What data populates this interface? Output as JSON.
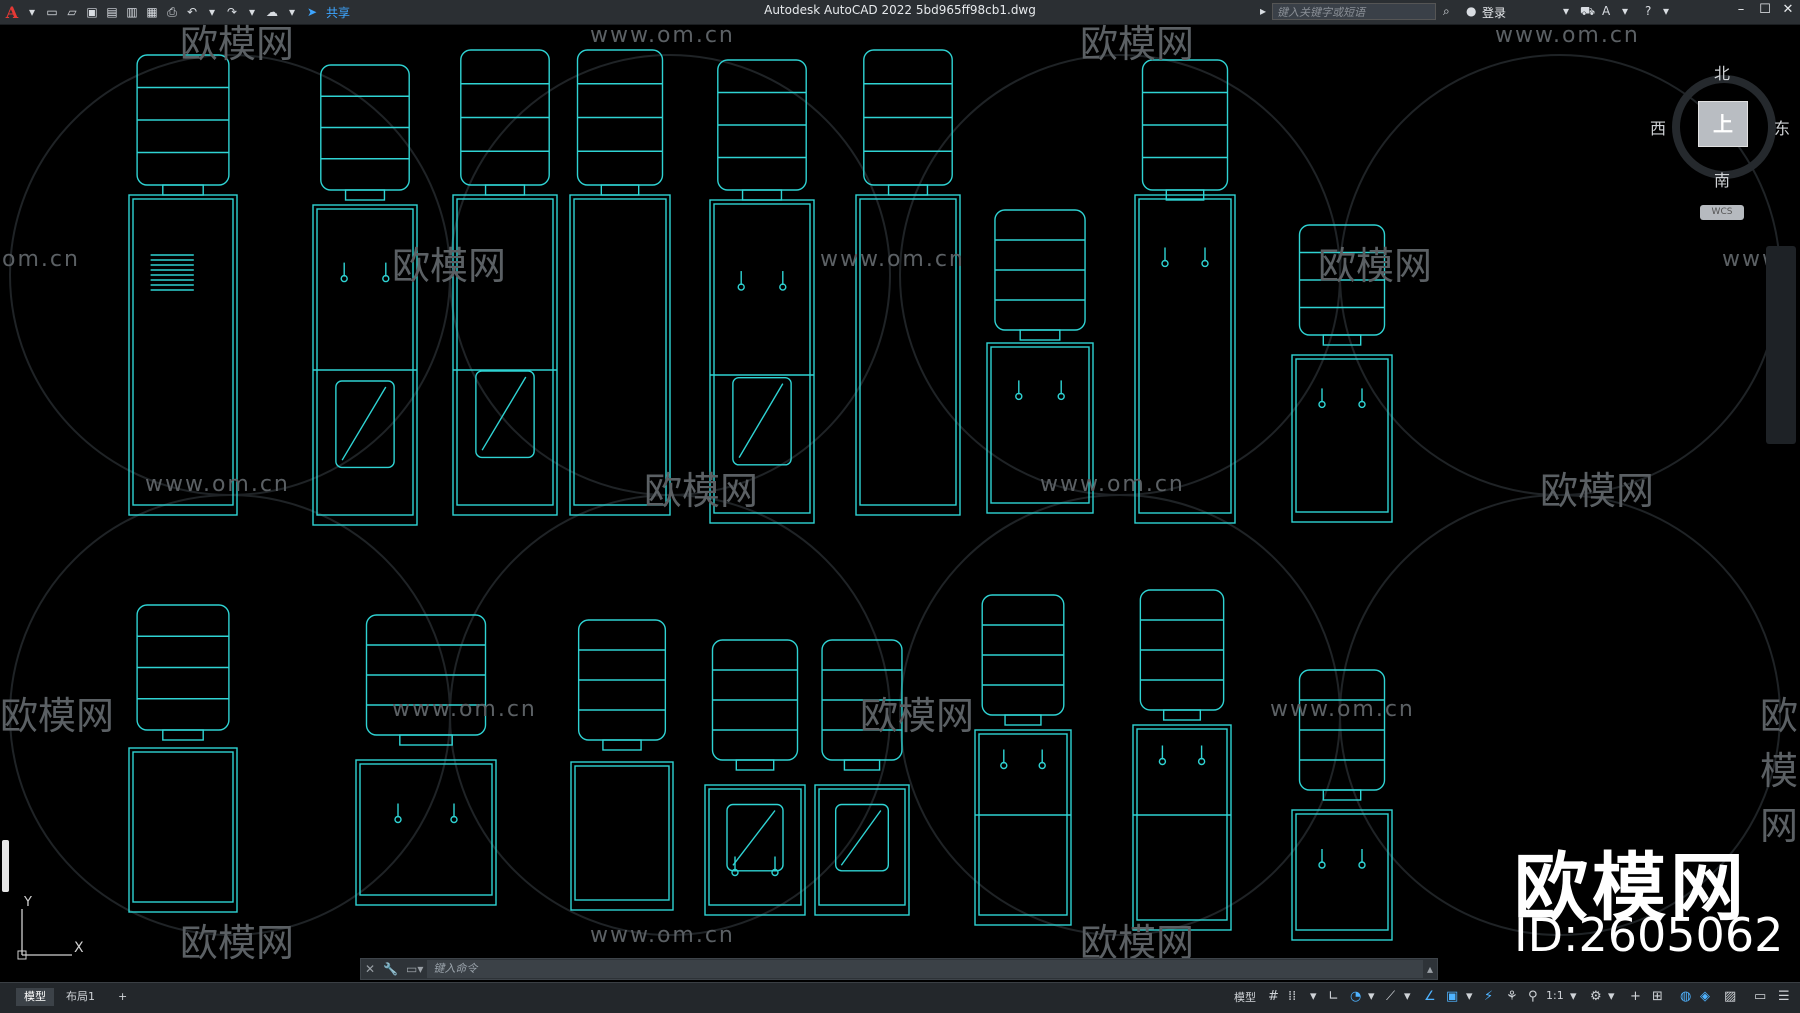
{
  "titlebar": {
    "app_logo": "A",
    "share_label": "共享",
    "title": "Autodesk AutoCAD 2022    5bd965ff98cb1.dwg",
    "search_placeholder": "键入关键字或短语",
    "login_label": "登录",
    "quick_access_icons": [
      "new-icon",
      "open-icon",
      "save-icon",
      "saveas-icon",
      "print-icon",
      "plot-icon",
      "undo-icon",
      "redo-icon",
      "share-icon"
    ]
  },
  "viewcube": {
    "north": "北",
    "south": "南",
    "west": "西",
    "east": "东",
    "face": "上",
    "wcs": "WCS"
  },
  "watermarks": {
    "brand": "欧模网",
    "url": "www.om.cn",
    "url_partial_left": "om.cn",
    "url_partial_right": "www.",
    "big_brand": "欧模网",
    "big_id": "ID:2605062"
  },
  "ucs": {
    "y": "Y",
    "x": "X"
  },
  "command_line": {
    "placeholder": "键入命令"
  },
  "statusbar": {
    "tabs": [
      "模型",
      "布局1"
    ],
    "add_tab": "+",
    "model_label": "模型",
    "scale": "1:1"
  },
  "drawing": {
    "line_color": "#2fd3d3",
    "object": "water dispensers"
  }
}
